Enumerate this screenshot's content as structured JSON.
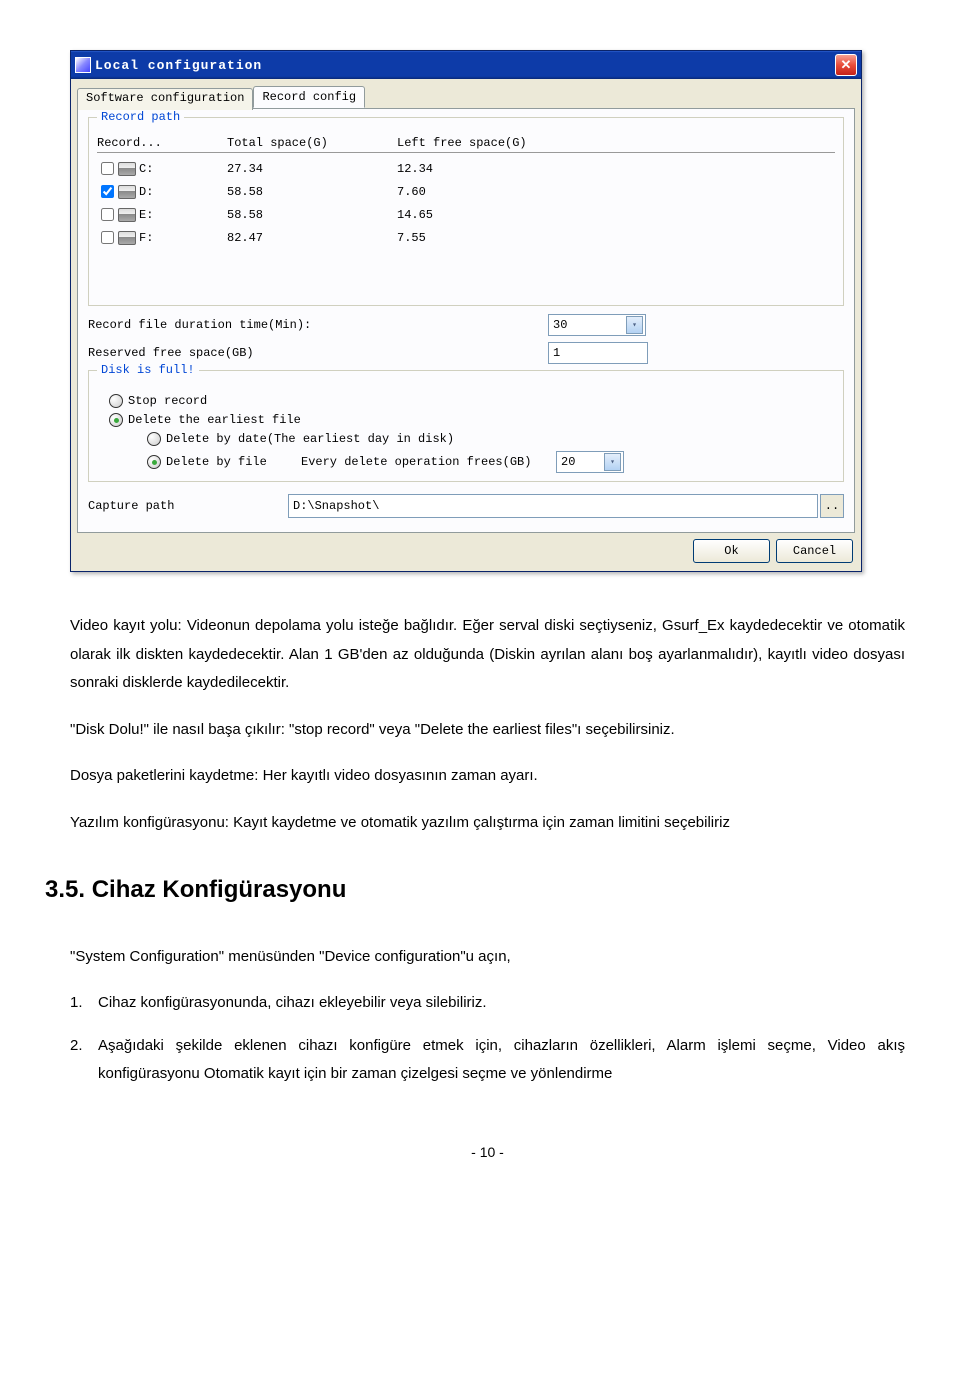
{
  "dialog": {
    "title": "Local configuration",
    "tabs": {
      "software": "Software configuration",
      "record": "Record config"
    },
    "recordPath": {
      "legend": "Record path",
      "columns": {
        "record": "Record...",
        "total": "Total space(G)",
        "left": "Left free space(G)"
      },
      "drives": [
        {
          "checked": false,
          "name": "C:",
          "total": "27.34",
          "left": "12.34"
        },
        {
          "checked": true,
          "name": "D:",
          "total": "58.58",
          "left": "7.60"
        },
        {
          "checked": false,
          "name": "E:",
          "total": "58.58",
          "left": "14.65"
        },
        {
          "checked": false,
          "name": "F:",
          "total": "82.47",
          "left": "7.55"
        }
      ]
    },
    "durationLabel": "Record file duration time(Min):",
    "durationValue": "30",
    "reservedLabel": "Reserved free space(GB)",
    "reservedValue": "1",
    "diskFull": {
      "legend": "Disk is full!",
      "stopRecord": "Stop record",
      "deleteEarliest": "Delete the earliest file",
      "deleteByDate": "Delete by date(The earliest day in disk)",
      "deleteByFile": "Delete by file",
      "everyDeleteLabel": "Every delete operation frees(GB)",
      "everyDeleteValue": "20"
    },
    "capturePathLabel": "Capture path",
    "capturePathValue": "D:\\Snapshot\\",
    "browseLabel": "..",
    "okLabel": "Ok",
    "cancelLabel": "Cancel"
  },
  "doc": {
    "p1": "Video kayıt yolu: Videonun depolama yolu isteğe bağlıdır. Eğer serval diski seçtiyseniz, Gsurf_Ex kaydedecektir ve otomatik olarak ilk diskten kaydedecektir. Alan 1 GB'den az olduğunda (Diskin ayrılan alanı boş ayarlanmalıdır), kayıtlı video dosyası sonraki disklerde kaydedilecektir.",
    "p2": "\"Disk Dolu!\" ile nasıl başa çıkılır: \"stop record\" veya \"Delete the earliest files\"ı seçebilirsiniz.",
    "p3": "Dosya paketlerini kaydetme: Her kayıtlı video dosyasının zaman ayarı.",
    "p4": "Yazılım konfigürasyonu: Kayıt kaydetme ve otomatik yazılım çalıştırma için zaman limitini seçebiliriz",
    "h35": "3.5. Cihaz Konfigürasyonu",
    "p5": "\"System Configuration\" menüsünden \"Device configuration\"u açın,",
    "li1": "Cihaz konfigürasyonunda, cihazı ekleyebilir veya silebiliriz.",
    "li2": "Aşağıdaki şekilde eklenen cihazı konfigüre etmek için, cihazların özellikleri, Alarm işlemi seçme, Video akış konfigürasyonu Otomatik kayıt için bir zaman çizelgesi seçme ve yönlendirme",
    "pageNum": "- 10 -"
  }
}
